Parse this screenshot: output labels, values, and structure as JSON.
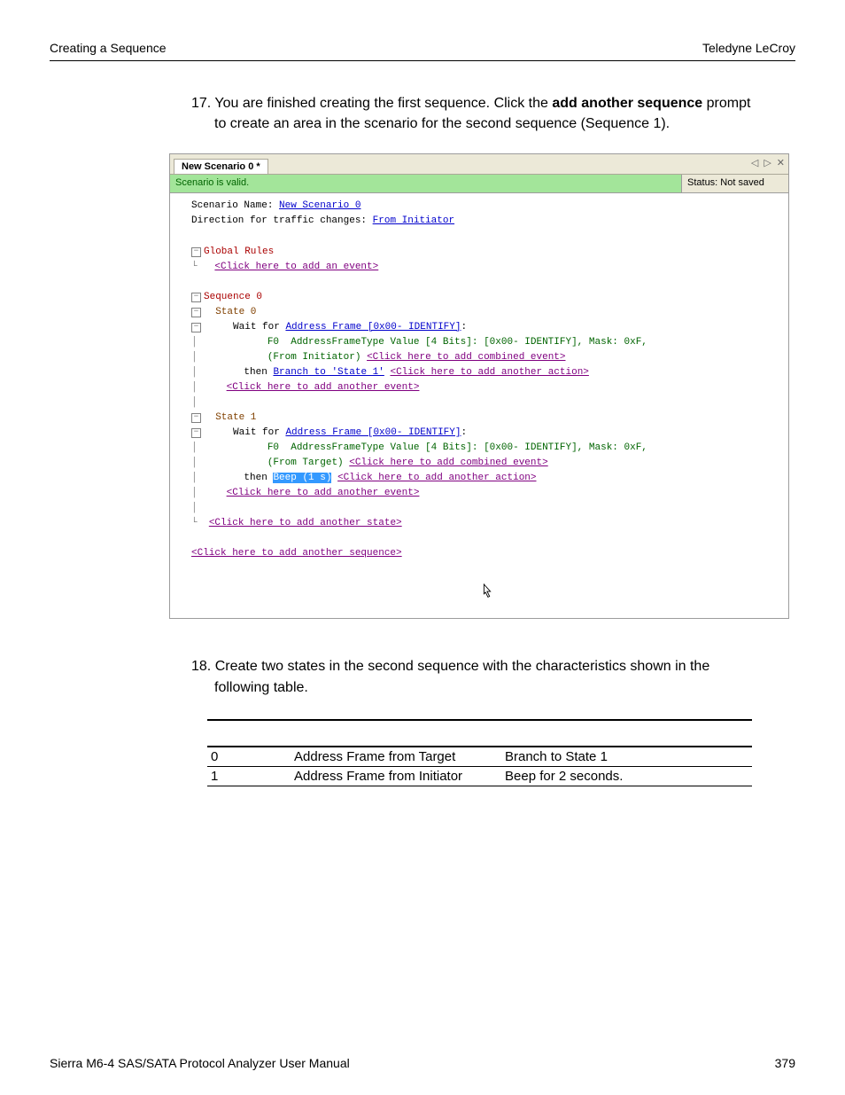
{
  "header": {
    "left": "Creating a Sequence",
    "right": "Teledyne LeCroy"
  },
  "step17": {
    "num": "17.",
    "line1a": "You are finished creating the first sequence. Click the ",
    "bold": "add another sequence",
    "line1b": " prompt",
    "line2": "to create an area in the scenario for the second sequence (Sequence 1)."
  },
  "shot": {
    "tab": "New Scenario 0 *",
    "nav_left_icon": "◁",
    "nav_right_icon": "▷",
    "nav_close_icon": "✕",
    "valid": "Scenario is valid.",
    "status": "Status: Not saved",
    "l1a": "Scenario Name: ",
    "l1b": "New Scenario 0",
    "l2a": "Direction for traffic changes: ",
    "l2b": "From Initiator",
    "glob": "Global Rules",
    "addEvent": "<Click here to add an event>",
    "seq0": "Sequence 0",
    "state0": "State 0",
    "wait": "Wait for ",
    "addrFrame": "Address Frame [0x00- IDENTIFY]",
    "colon": ":",
    "f0line": "F0  AddressFrameType Value [4 Bits]: [0x00- IDENTIFY], Mask: 0xF,",
    "fromInit": "(From Initiator)",
    "addComb": "<Click here to add combined event>",
    "then": "then ",
    "branch": "Branch to 'State 1'",
    "addAction": "<Click here to add another action>",
    "addAnEvent": "<Click here to add another event>",
    "state1": "State 1",
    "fromTarget": "(From Target)",
    "beep": "Beep (1 s)",
    "addState": "<Click here to add another state>",
    "addSeq": "<Click here to add another sequence>",
    "toggle_minus": "−"
  },
  "step18": {
    "num": "18.",
    "line1": "Create two states in the second sequence with the characteristics shown in the",
    "line2": "following table."
  },
  "table": {
    "r0": {
      "c0": "0",
      "c1": "Address Frame from Target",
      "c2": "Branch to State 1"
    },
    "r1": {
      "c0": "1",
      "c1": "Address Frame from Initiator",
      "c2": "Beep for 2 seconds."
    }
  },
  "footer": {
    "left": "Sierra M6-4 SAS/SATA Protocol Analyzer User Manual",
    "right": "379"
  }
}
